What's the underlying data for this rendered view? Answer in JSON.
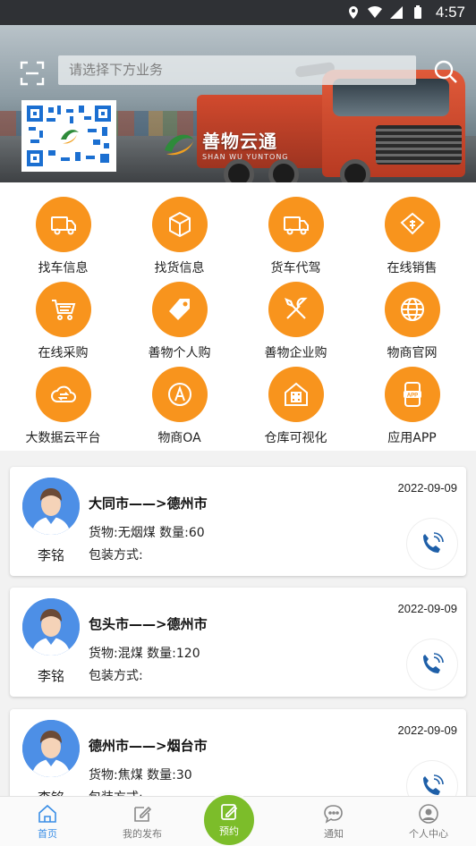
{
  "status_bar": {
    "time": "4:57"
  },
  "search": {
    "placeholder": "请选择下方业务"
  },
  "brand": {
    "name": "善物云通",
    "subtitle": "SHAN WU YUNTONG"
  },
  "menu": [
    {
      "label": "找车信息",
      "icon": "truck-icon"
    },
    {
      "label": "找货信息",
      "icon": "box-icon"
    },
    {
      "label": "货车代驾",
      "icon": "truck-icon"
    },
    {
      "label": "在线销售",
      "icon": "bag-money-icon"
    },
    {
      "label": "在线采购",
      "icon": "cart-icon"
    },
    {
      "label": "善物个人购",
      "icon": "tag-icon"
    },
    {
      "label": "善物企业购",
      "icon": "tools-icon"
    },
    {
      "label": "物商官网",
      "icon": "globe-icon"
    },
    {
      "label": "大数据云平台",
      "icon": "cloud-icon"
    },
    {
      "label": "物商OA",
      "icon": "letter-a-icon"
    },
    {
      "label": "仓库可视化",
      "icon": "warehouse-icon"
    },
    {
      "label": "应用APP",
      "icon": "app-icon"
    }
  ],
  "cards": [
    {
      "name": "李铭",
      "route": "大同市——>德州市",
      "date": "2022-09-09",
      "goods": "货物:无烟煤  数量:60",
      "pack": "包装方式:"
    },
    {
      "name": "李铭",
      "route": "包头市——>德州市",
      "date": "2022-09-09",
      "goods": "货物:混煤  数量:120",
      "pack": "包装方式:"
    },
    {
      "name": "李铭",
      "route": "德州市——>烟台市",
      "date": "2022-09-09",
      "goods": "货物:焦煤  数量:30",
      "pack": "包装方式:"
    }
  ],
  "tabs": [
    {
      "label": "首页",
      "icon": "home-icon",
      "active": true
    },
    {
      "label": "我的发布",
      "icon": "edit-icon"
    },
    {
      "label": "预约",
      "icon": "edit-icon"
    },
    {
      "label": "通知",
      "icon": "chat-icon"
    },
    {
      "label": "个人中心",
      "icon": "person-icon"
    }
  ],
  "colors": {
    "accent_orange": "#f8941d",
    "tab_active": "#3a8ee6",
    "center_tab": "#7cbd2a",
    "avatar_bg": "#4d8fe6"
  }
}
